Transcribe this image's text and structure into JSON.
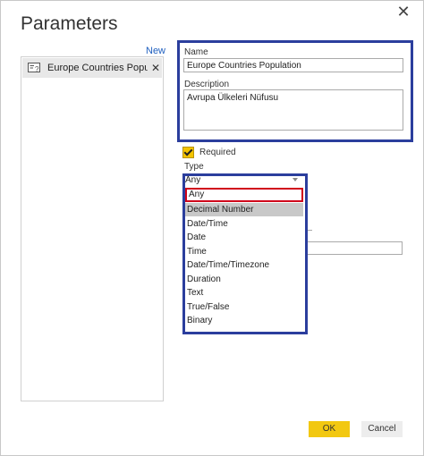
{
  "dialog": {
    "title": "Parameters",
    "close_glyph": "✕"
  },
  "sidebar": {
    "new_label": "New",
    "items": [
      {
        "label": "Europe Countries Popula...",
        "icon": "parameter-icon",
        "close_glyph": "✕"
      }
    ]
  },
  "form": {
    "name_label": "Name",
    "name_value": "Europe Countries Population",
    "description_label": "Description",
    "description_value": "Avrupa Ülkeleri Nüfusu",
    "required_label": "Required",
    "required_checked": true,
    "type_label": "Type",
    "type_selected": "Any"
  },
  "type_options": [
    "Any",
    "Decimal Number",
    "Date/Time",
    "Date",
    "Time",
    "Date/Time/Timezone",
    "Duration",
    "Text",
    "True/False",
    "Binary"
  ],
  "highlighted_option": "Decimal Number",
  "buttons": {
    "ok": "OK",
    "cancel": "Cancel"
  },
  "colors": {
    "annotation_blue": "#2b3e9d",
    "annotation_red": "#d0021b",
    "ok_yellow": "#f2c811",
    "checkbox_yellow": "#f4c400"
  }
}
